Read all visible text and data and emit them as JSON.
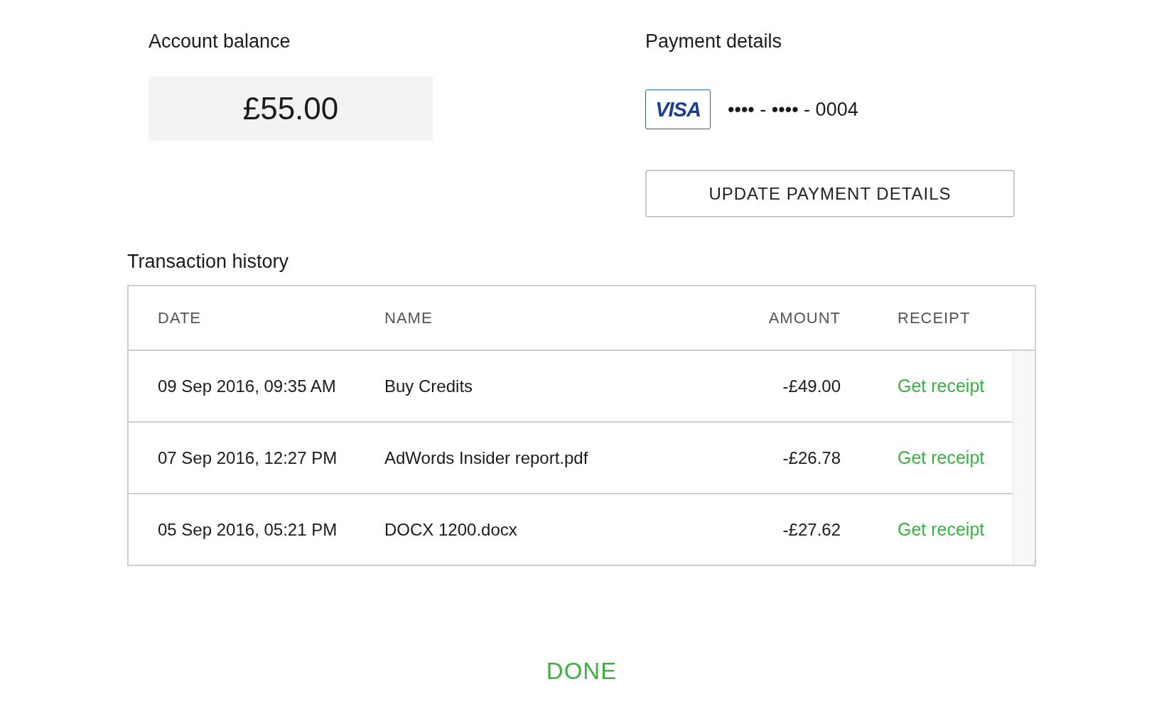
{
  "account_balance": {
    "label": "Account balance",
    "amount": "£55.00"
  },
  "payment_details": {
    "label": "Payment details",
    "card_brand": "VISA",
    "card_number": "•••• - •••• - 0004",
    "update_button": "UPDATE PAYMENT DETAILS"
  },
  "transaction_history": {
    "title": "Transaction history",
    "columns": [
      "DATE",
      "NAME",
      "AMOUNT",
      "RECEIPT"
    ],
    "rows": [
      {
        "date": "09 Sep 2016, 09:35 AM",
        "name": "Buy Credits",
        "amount": "-£49.00",
        "receipt": "Get receipt"
      },
      {
        "date": "07 Sep 2016, 12:27 PM",
        "name": "AdWords Insider report.pdf",
        "amount": "-£26.78",
        "receipt": "Get receipt"
      },
      {
        "date": "05 Sep 2016, 05:21 PM",
        "name": "DOCX 1200.docx",
        "amount": "-£27.62",
        "receipt": "Get receipt"
      }
    ]
  },
  "done_button": "DONE"
}
